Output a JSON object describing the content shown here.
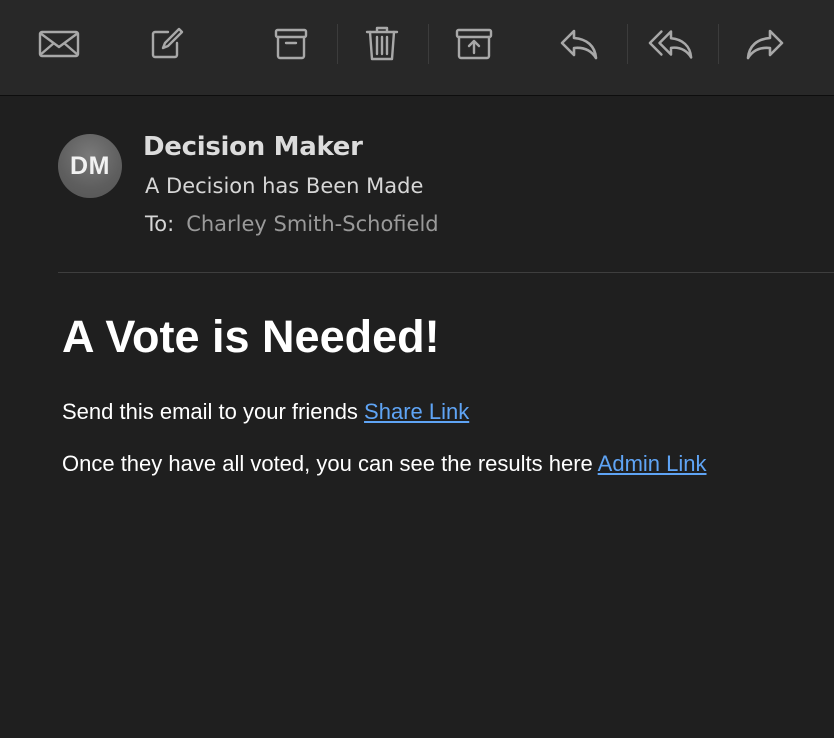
{
  "toolbar": {
    "buttons": [
      {
        "name": "get-mail",
        "icon": "envelope-icon"
      },
      {
        "name": "compose",
        "icon": "compose-icon"
      },
      {
        "name": "archive",
        "icon": "archive-box-icon"
      },
      {
        "name": "delete",
        "icon": "trash-icon"
      },
      {
        "name": "move-to-junk",
        "icon": "junk-box-icon"
      },
      {
        "name": "reply",
        "icon": "reply-icon"
      },
      {
        "name": "reply-all",
        "icon": "reply-all-icon"
      },
      {
        "name": "forward",
        "icon": "forward-icon"
      }
    ],
    "icon_color": "#a8a8a8"
  },
  "message": {
    "avatar_initials": "DM",
    "sender": "Decision Maker",
    "subject": "A Decision has Been Made",
    "to_label": "To:",
    "to_value": "Charley Smith-Schofield"
  },
  "body": {
    "heading": "A Vote is Needed!",
    "line1_text": "Send this email to your friends ",
    "line1_link": "Share Link",
    "line2_text": "Once they have all voted, you can see the results here ",
    "line2_link": "Admin Link"
  },
  "colors": {
    "background": "#1f1f1f",
    "toolbar": "#282828",
    "link": "#5fa4f5",
    "text": "#ffffff"
  }
}
